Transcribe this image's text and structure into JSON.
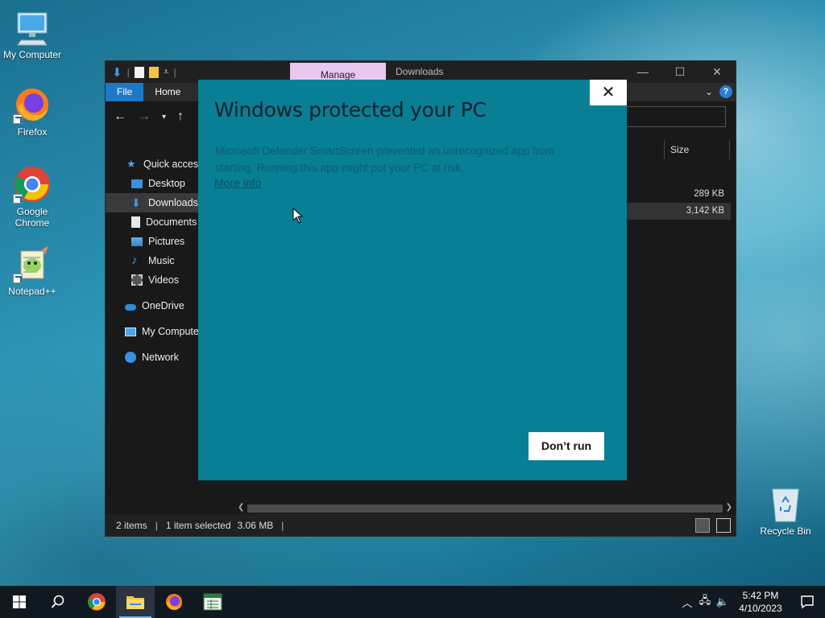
{
  "desktop": {
    "icons": [
      {
        "label": "My Computer"
      },
      {
        "label": "Firefox"
      },
      {
        "label": "Google Chrome"
      },
      {
        "label": "Notepad++"
      },
      {
        "label": "Recycle Bin"
      }
    ]
  },
  "explorer": {
    "manage_tab": "Manage",
    "title": "Downloads",
    "ribbon_tabs": [
      "File",
      "Home"
    ],
    "sidebar": [
      {
        "label": "Quick access",
        "icon": "star-icon"
      },
      {
        "label": "Desktop",
        "icon": "desktop-folder-icon"
      },
      {
        "label": "Downloads",
        "icon": "download-arrow-icon"
      },
      {
        "label": "Documents",
        "icon": "document-icon"
      },
      {
        "label": "Pictures",
        "icon": "pictures-icon"
      },
      {
        "label": "Music",
        "icon": "music-note-icon"
      },
      {
        "label": "Videos",
        "icon": "film-icon"
      },
      {
        "label": "OneDrive",
        "icon": "cloud-icon"
      },
      {
        "label": "My Computer",
        "icon": "computer-icon"
      },
      {
        "label": "Network",
        "icon": "network-icon"
      }
    ],
    "column_header_size": "Size",
    "file_sizes": [
      "289 KB",
      "3,142 KB"
    ],
    "status": {
      "items": "2 items",
      "selected": "1 item selected",
      "size": "3.06 MB"
    }
  },
  "dialog": {
    "title": "Windows protected your PC",
    "message": "Microsoft Defender SmartScreen prevented an unrecognized app from starting. Running this app might put your PC at risk.",
    "more_info": "More info",
    "dont_run": "Don’t run",
    "close_symbol": "✕"
  },
  "taskbar": {
    "time": "5:42 PM",
    "date": "4/10/2023"
  },
  "colors": {
    "dialog_bg": "#087f95",
    "manage_tab": "#e8c7f0",
    "file_tab": "#1e78c8"
  }
}
